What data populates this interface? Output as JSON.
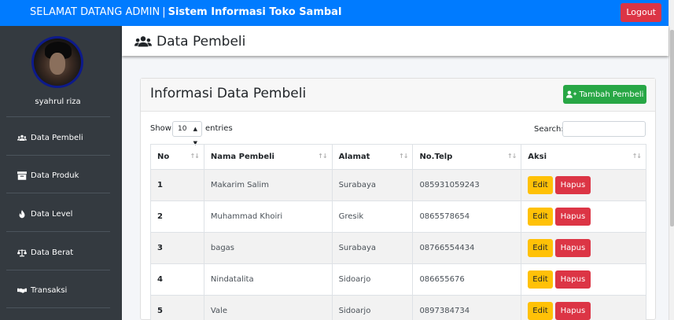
{
  "navbar": {
    "greeting": "SELAMAT DATANG ADMIN",
    "separator": "|",
    "app_name": "Sistem Informasi Toko Sambal",
    "logout_label": "Logout"
  },
  "sidebar": {
    "username": "syahrul riza",
    "items": [
      {
        "label": "Data Pembeli",
        "icon": "users-icon"
      },
      {
        "label": "Data Produk",
        "icon": "box-icon"
      },
      {
        "label": "Data Level",
        "icon": "fire-icon"
      },
      {
        "label": "Data Berat",
        "icon": "balance-scale-icon"
      },
      {
        "label": "Transaksi",
        "icon": "handshake-icon"
      }
    ]
  },
  "header": {
    "title": "Data Pembeli",
    "icon": "users-icon"
  },
  "card": {
    "title": "Informasi Data Pembeli",
    "add_button_label": "Tambah Pembeli"
  },
  "table_controls": {
    "show_label": "Show",
    "entries_value": "10",
    "entries_label": "entries",
    "search_label": "Search:",
    "search_value": ""
  },
  "table": {
    "columns": [
      "No",
      "Nama Pembeli",
      "Alamat",
      "No.Telp",
      "Aksi"
    ],
    "rows": [
      {
        "no": "1",
        "nama": "Makarim Salim",
        "alamat": "Surabaya",
        "telp": "085931059243"
      },
      {
        "no": "2",
        "nama": "Muhammad Khoiri",
        "alamat": "Gresik",
        "telp": "0865578654"
      },
      {
        "no": "3",
        "nama": "bagas",
        "alamat": "Surabaya",
        "telp": "08766554434"
      },
      {
        "no": "4",
        "nama": "Nindatalita",
        "alamat": "Sidoarjo",
        "telp": "086655676"
      },
      {
        "no": "5",
        "nama": "Vale",
        "alamat": "Sidoarjo",
        "telp": "0897384734"
      }
    ],
    "edit_label": "Edit",
    "delete_label": "Hapus"
  },
  "colors": {
    "navbar": "#007bff",
    "sidebar": "#343a40",
    "logout": "#dc3545",
    "add_button": "#28a745",
    "edit_button": "#ffc107",
    "delete_button": "#dc3545"
  }
}
